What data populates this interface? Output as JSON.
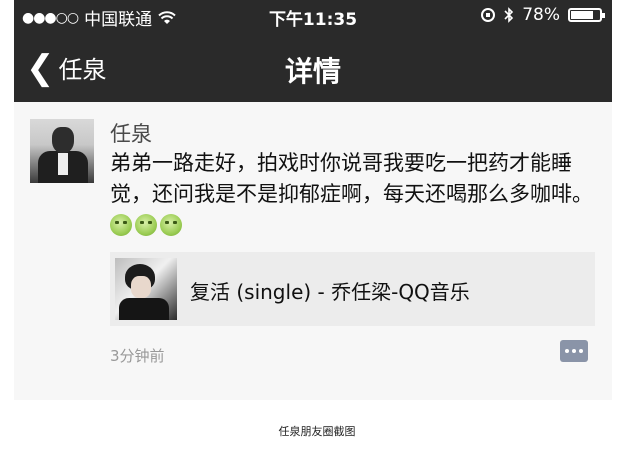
{
  "status_bar": {
    "signal": "●●●○○",
    "carrier": "中国联通",
    "wifi_icon": "wifi-icon",
    "time": "下午11:35",
    "battery_percent": "78%",
    "battery_level": 0.78
  },
  "nav": {
    "back_label": "任泉",
    "title": "详情"
  },
  "post": {
    "author": "任泉",
    "text": "弟弟一路走好，拍戏时你说哥我要吃一把药才能睡觉，还问我是不是抑郁症啊，每天还喝那么多咖啡。",
    "emoji_count": 3,
    "music_card": {
      "title": "复活 (single) - 乔任梁-QQ音乐"
    },
    "time": "3分钟前"
  },
  "caption": "任泉朋友圈截图"
}
